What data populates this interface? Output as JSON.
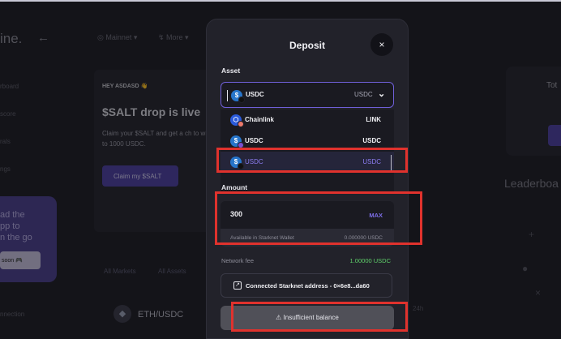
{
  "background": {
    "logo": "ine.",
    "back_arrow": "←",
    "network": "◎ Mainnet ▾",
    "more": "↯ More ▾",
    "sidebar": [
      "rboard",
      "score",
      "rals",
      "ngs"
    ],
    "promo_text": "ad the\npp to\nn the go",
    "promo_button": "soon 🎮",
    "sidebar_bottom": "nnection",
    "card_kicker": "HEY ASDASD 👋",
    "card_title": "$SALT drop is live",
    "card_desc": "Claim your $SALT and get a ch to win up to 1000 USDC.",
    "card_button": "Claim my $SALT",
    "tabs": [
      "All Markets",
      "All Assets"
    ],
    "market_row": "ETH/USDC",
    "right_card_title": "Tot",
    "leaderboard": "Leaderboa",
    "vol_label": "24h"
  },
  "modal": {
    "title": "Deposit",
    "close": "×",
    "asset_label": "Asset",
    "selected": {
      "name": "USDC",
      "symbol": "USDC"
    },
    "options": [
      {
        "name": "Chainlink",
        "symbol": "LINK",
        "icon": "chainlink-icon"
      },
      {
        "name": "USDC",
        "symbol": "USDC",
        "icon": "usdc-icon"
      },
      {
        "name": "USDC",
        "symbol": "USDC",
        "icon": "usdc-icon"
      }
    ],
    "amount_label": "Amount",
    "amount_value": "300",
    "max_label": "MAX",
    "available_label": "Available in Starknet Wallet",
    "available_balance": "0.000000 USDC",
    "fee_label": "Network fee",
    "fee_value": "1.00000 USDC",
    "connected_text": "Connected Starknet address - 0×6e8...da60",
    "action_button": "⚠ Insufficient balance"
  },
  "colors": {
    "accent": "#6f5fd8",
    "highlight": "#e0322d",
    "fee_green": "#5fd06a"
  }
}
